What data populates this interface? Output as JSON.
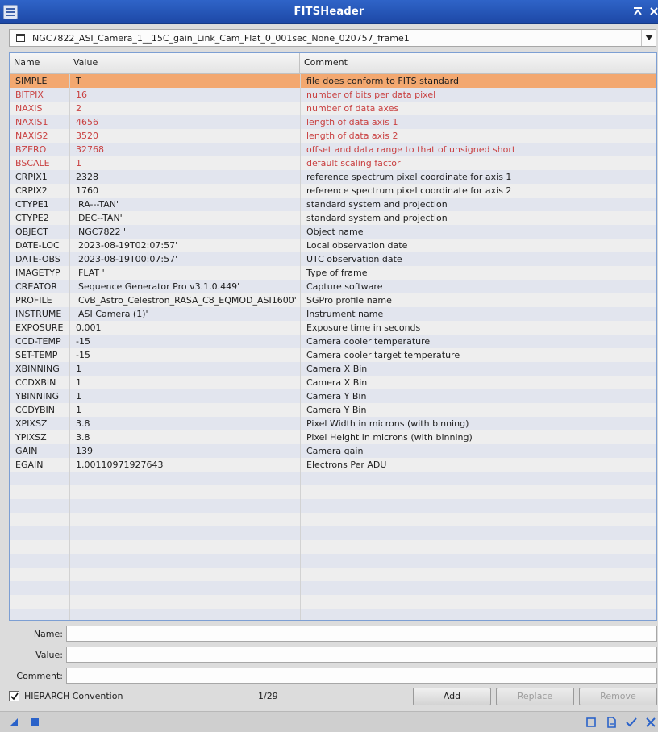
{
  "window": {
    "title": "FITSHeader"
  },
  "file_selector": {
    "selected": "NGC7822_ASI_Camera_1__15C_gain_Link_Cam_Flat_0_001sec_None_020757_frame1"
  },
  "table": {
    "columns": [
      "Name",
      "Value",
      "Comment"
    ],
    "rows": [
      {
        "name": "SIMPLE",
        "value": "T",
        "comment": "file does conform to FITS standard",
        "selected": true,
        "reserved": true
      },
      {
        "name": "BITPIX",
        "value": "16",
        "comment": "number of bits per data pixel",
        "reserved": true
      },
      {
        "name": "NAXIS",
        "value": "2",
        "comment": "number of data axes",
        "reserved": true
      },
      {
        "name": "NAXIS1",
        "value": "4656",
        "comment": "length of data axis 1",
        "reserved": true
      },
      {
        "name": "NAXIS2",
        "value": "3520",
        "comment": "length of data axis 2",
        "reserved": true
      },
      {
        "name": "BZERO",
        "value": "32768",
        "comment": "offset and data range to that of unsigned short",
        "reserved": true
      },
      {
        "name": "BSCALE",
        "value": "1",
        "comment": "default scaling factor",
        "reserved": true
      },
      {
        "name": "CRPIX1",
        "value": "2328",
        "comment": "reference spectrum pixel coordinate for axis 1"
      },
      {
        "name": "CRPIX2",
        "value": "1760",
        "comment": "reference spectrum pixel coordinate for axis 2"
      },
      {
        "name": "CTYPE1",
        "value": "'RA---TAN'",
        "comment": "standard system and projection"
      },
      {
        "name": "CTYPE2",
        "value": "'DEC--TAN'",
        "comment": "standard system and projection"
      },
      {
        "name": "OBJECT",
        "value": "'NGC7822 '",
        "comment": "Object name"
      },
      {
        "name": "DATE-LOC",
        "value": "'2023-08-19T02:07:57'",
        "comment": "Local observation date"
      },
      {
        "name": "DATE-OBS",
        "value": "'2023-08-19T00:07:57'",
        "comment": "UTC observation date"
      },
      {
        "name": "IMAGETYP",
        "value": "'FLAT    '",
        "comment": "Type of frame"
      },
      {
        "name": "CREATOR",
        "value": "'Sequence Generator Pro v3.1.0.449'",
        "comment": "Capture software"
      },
      {
        "name": "PROFILE",
        "value": "'CvB_Astro_Celestron_RASA_C8_EQMOD_ASI1600'",
        "comment": "SGPro profile name"
      },
      {
        "name": "INSTRUME",
        "value": "'ASI Camera (1)'",
        "comment": "Instrument name"
      },
      {
        "name": "EXPOSURE",
        "value": "0.001",
        "comment": "Exposure time in seconds"
      },
      {
        "name": "CCD-TEMP",
        "value": "-15",
        "comment": "Camera cooler temperature"
      },
      {
        "name": "SET-TEMP",
        "value": "-15",
        "comment": "Camera cooler target temperature"
      },
      {
        "name": "XBINNING",
        "value": "1",
        "comment": "Camera X Bin"
      },
      {
        "name": "CCDXBIN",
        "value": "1",
        "comment": "Camera X Bin"
      },
      {
        "name": "YBINNING",
        "value": "1",
        "comment": "Camera Y Bin"
      },
      {
        "name": "CCDYBIN",
        "value": "1",
        "comment": "Camera Y Bin"
      },
      {
        "name": "XPIXSZ",
        "value": "3.8",
        "comment": "Pixel Width in microns (with binning)"
      },
      {
        "name": "YPIXSZ",
        "value": "3.8",
        "comment": "Pixel Height in microns (with binning)"
      },
      {
        "name": "GAIN",
        "value": "139",
        "comment": "Camera gain"
      },
      {
        "name": "EGAIN",
        "value": "1.00110971927643",
        "comment": "Electrons Per ADU"
      }
    ]
  },
  "form": {
    "name_label": "Name:",
    "value_label": "Value:",
    "comment_label": "Comment:",
    "name_value": "",
    "value_value": "",
    "comment_value": ""
  },
  "footer": {
    "hierarch_label": "HIERARCH Convention",
    "hierarch_checked": true,
    "counter": "1/29",
    "add_label": "Add",
    "replace_label": "Replace",
    "remove_label": "Remove"
  },
  "colors": {
    "selected_row": "#f3a870",
    "reserved_keyword": "#c94040",
    "title_bar": "#2f64c8"
  }
}
